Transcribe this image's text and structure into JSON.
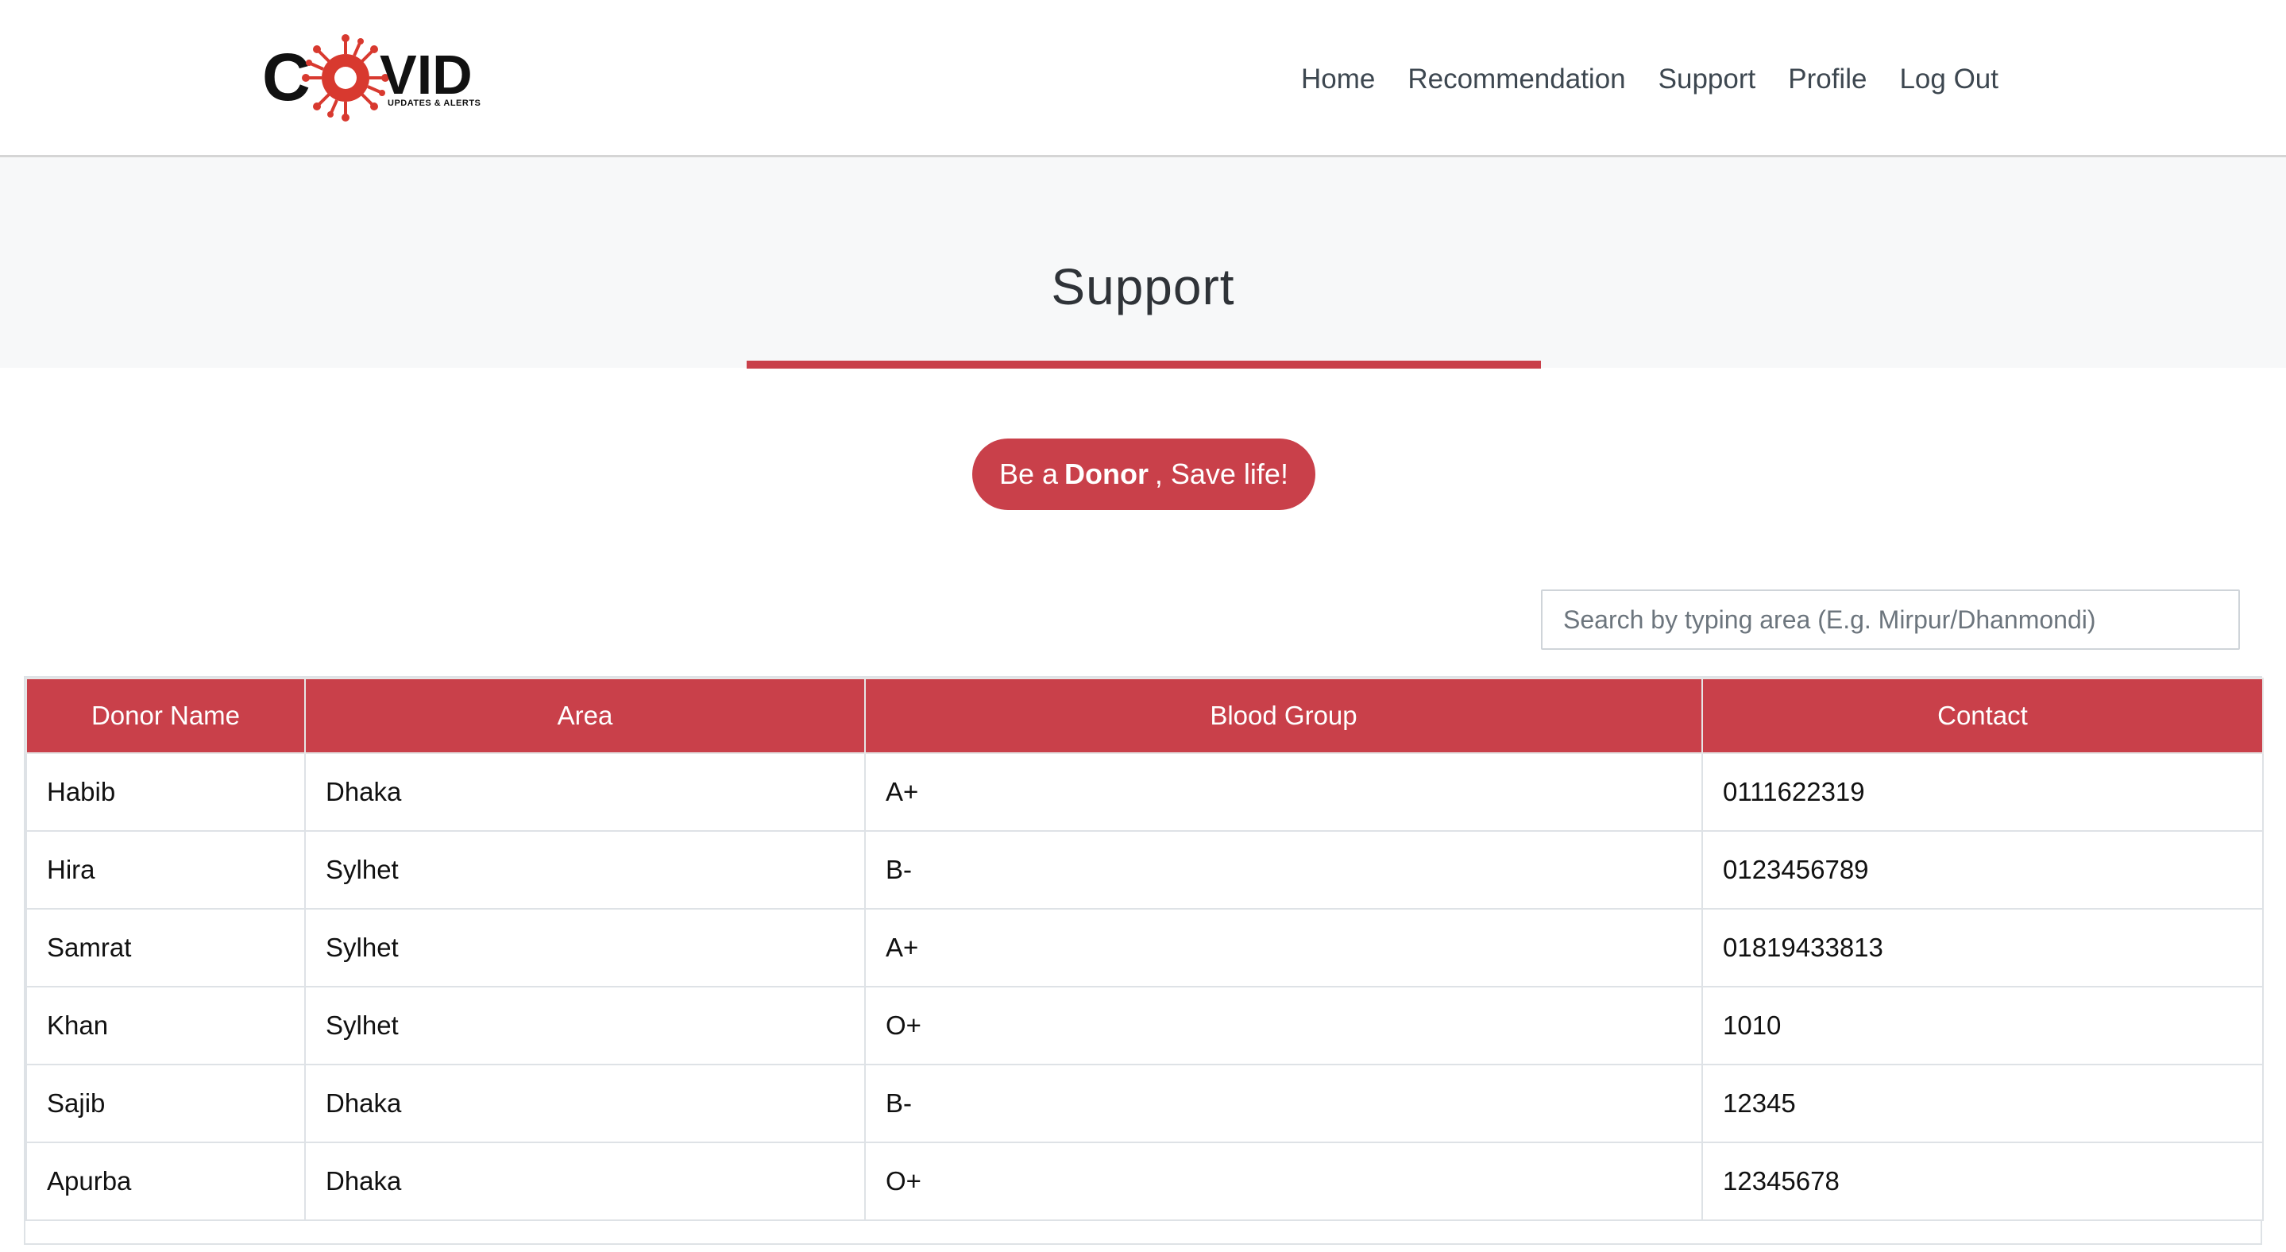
{
  "header": {
    "logo": {
      "word": "COVID",
      "tagline": "UPDATES & ALERTS",
      "virus_color": "#d8392f"
    },
    "nav": [
      "Home",
      "Recommendation",
      "Support",
      "Profile",
      "Log Out"
    ]
  },
  "hero": {
    "title": "Support",
    "accent_color": "#c9404a"
  },
  "donor_button": {
    "prefix": "Be a",
    "emphasis": "Donor",
    "suffix": ", Save life!"
  },
  "search": {
    "placeholder": "Search by typing area (E.g. Mirpur/Dhanmondi)",
    "value": ""
  },
  "table": {
    "columns": [
      "Donor Name",
      "Area",
      "Blood Group",
      "Contact"
    ],
    "rows": [
      [
        "Habib",
        "Dhaka",
        "A+",
        "0111622319"
      ],
      [
        "Hira",
        "Sylhet",
        "B-",
        "0123456789"
      ],
      [
        "Samrat",
        "Sylhet",
        "A+",
        "01819433813"
      ],
      [
        "Khan",
        "Sylhet",
        "O+",
        "1010"
      ],
      [
        "Sajib",
        "Dhaka",
        "B-",
        "12345"
      ],
      [
        "Apurba",
        "Dhaka",
        "O+",
        "12345678"
      ]
    ]
  }
}
